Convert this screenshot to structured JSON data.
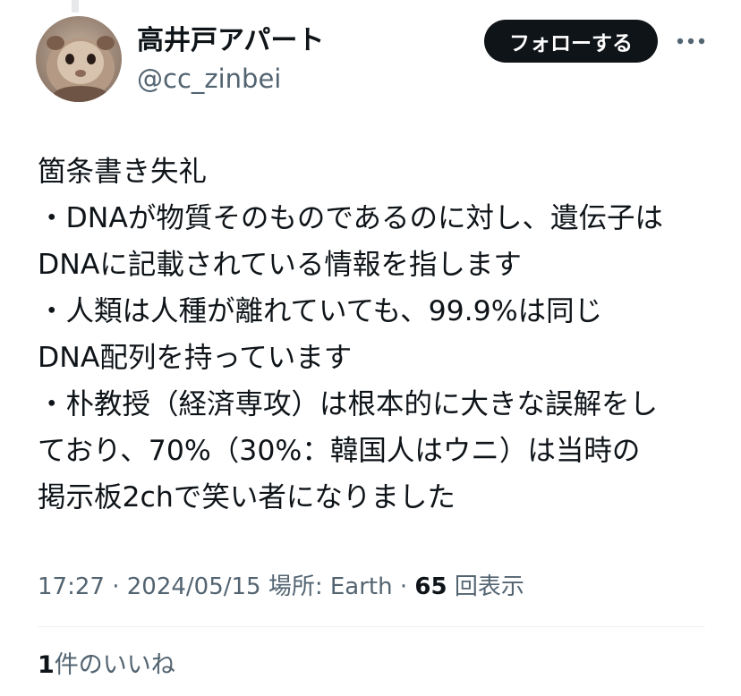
{
  "author": {
    "display_name": "高井戸アパート",
    "handle": "@cc_zinbei",
    "avatar_icon": "guinea-pig-avatar"
  },
  "actions": {
    "follow_label": "フォローする",
    "more_icon": "more-dots-icon"
  },
  "tweet": {
    "lines": [
      "箇条書き失礼",
      "・DNAが物質そのものであるのに対し、遺伝子は",
      "DNAに記載されている情報を指します",
      "・人類は人種が離れていても、99.9%は同じ",
      "DNA配列を持っています",
      "・朴教授（経済専攻）は根本的に大きな誤解をし",
      "ており、70%（30%：韓国人はウニ）は当時の",
      "掲示板2chで笑い者になりました"
    ]
  },
  "meta": {
    "time": "17:27",
    "date": "2024/05/15",
    "location": "場所: Earth",
    "views_count": "65",
    "views_label": "回表示"
  },
  "engagement": {
    "likes_count": "1",
    "likes_label": "件のいいね"
  }
}
